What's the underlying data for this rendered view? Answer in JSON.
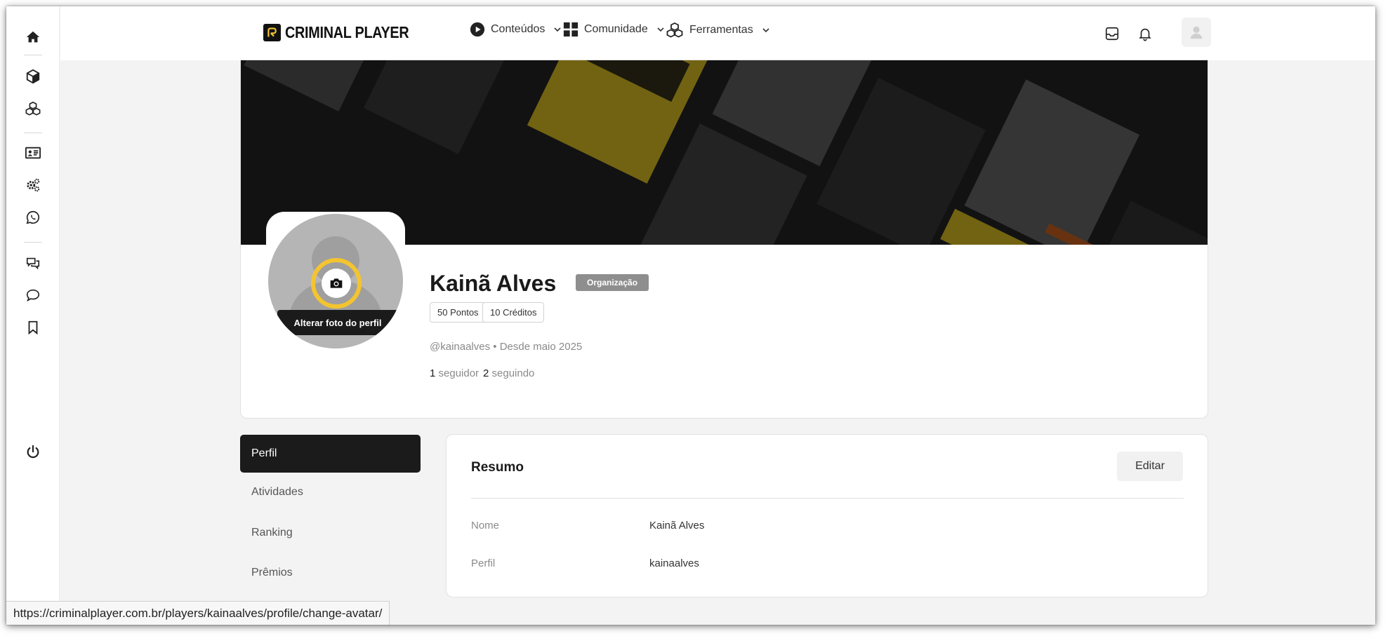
{
  "header": {
    "brand": "CRIMINAL PLAYER",
    "nav": [
      {
        "label": "Conteúdos",
        "icon": "play-circle-icon"
      },
      {
        "label": "Comunidade",
        "icon": "grid-icon"
      },
      {
        "label": "Ferramentas",
        "icon": "cubes-icon"
      }
    ],
    "icons": [
      "inbox-icon",
      "bell-icon",
      "user-avatar-icon"
    ]
  },
  "sidebar": {
    "icons": [
      "home-icon",
      "box-icon",
      "cubes-icon",
      "id-card-icon",
      "gears-icon",
      "whatsapp-icon",
      "comments-icon",
      "comment-icon",
      "bookmark-icon",
      "power-icon"
    ]
  },
  "profile": {
    "name": "Kainã Alves",
    "badge": "Organização",
    "points": "50 Pontos",
    "credits": "10 Créditos",
    "meta": "@kainaalves • Desde maio 2025",
    "followers_count": "1",
    "followers_label": "seguidor",
    "following_count": "2",
    "following_label": "seguindo",
    "avatar_tooltip": "Alterar foto do perfil"
  },
  "tabs": [
    "Perfil",
    "Atividades",
    "Ranking",
    "Prêmios"
  ],
  "summary": {
    "title": "Resumo",
    "edit_label": "Editar",
    "rows": [
      {
        "label": "Nome",
        "value": "Kainã Alves"
      },
      {
        "label": "Perfil",
        "value": "kainaalves"
      }
    ]
  },
  "status_bar": {
    "url": "https://criminalplayer.com.br/players/kainaalves/profile/change-avatar/"
  },
  "colors": {
    "accent": "#f4c430",
    "active_tab": "#1b1b1b",
    "badge": "#8e8e8e"
  }
}
